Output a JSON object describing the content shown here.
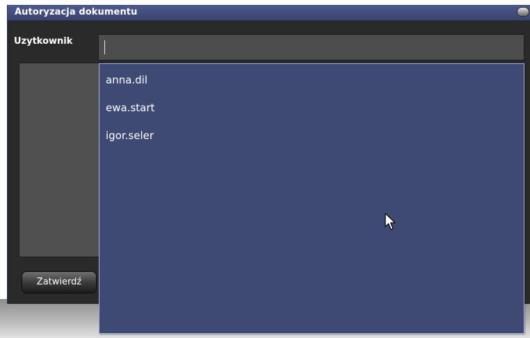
{
  "dialog": {
    "title": "Autoryzacja dokumentu"
  },
  "form": {
    "user_label": "Uzytkownik",
    "user_value": "",
    "submit_label": "Zatwierdź"
  },
  "dropdown": {
    "options": [
      "anna.dil",
      "ewa.start",
      "igor.seler"
    ]
  },
  "colors": {
    "dialog_blue": "#3f4a74",
    "dropdown_border": "#a9b3d3",
    "content_dark": "#2a2a2a",
    "input_grey": "#4d4d4d"
  },
  "icons": {
    "titlebar_button": "window-control-icon",
    "cursor": "mouse-pointer-icon"
  }
}
